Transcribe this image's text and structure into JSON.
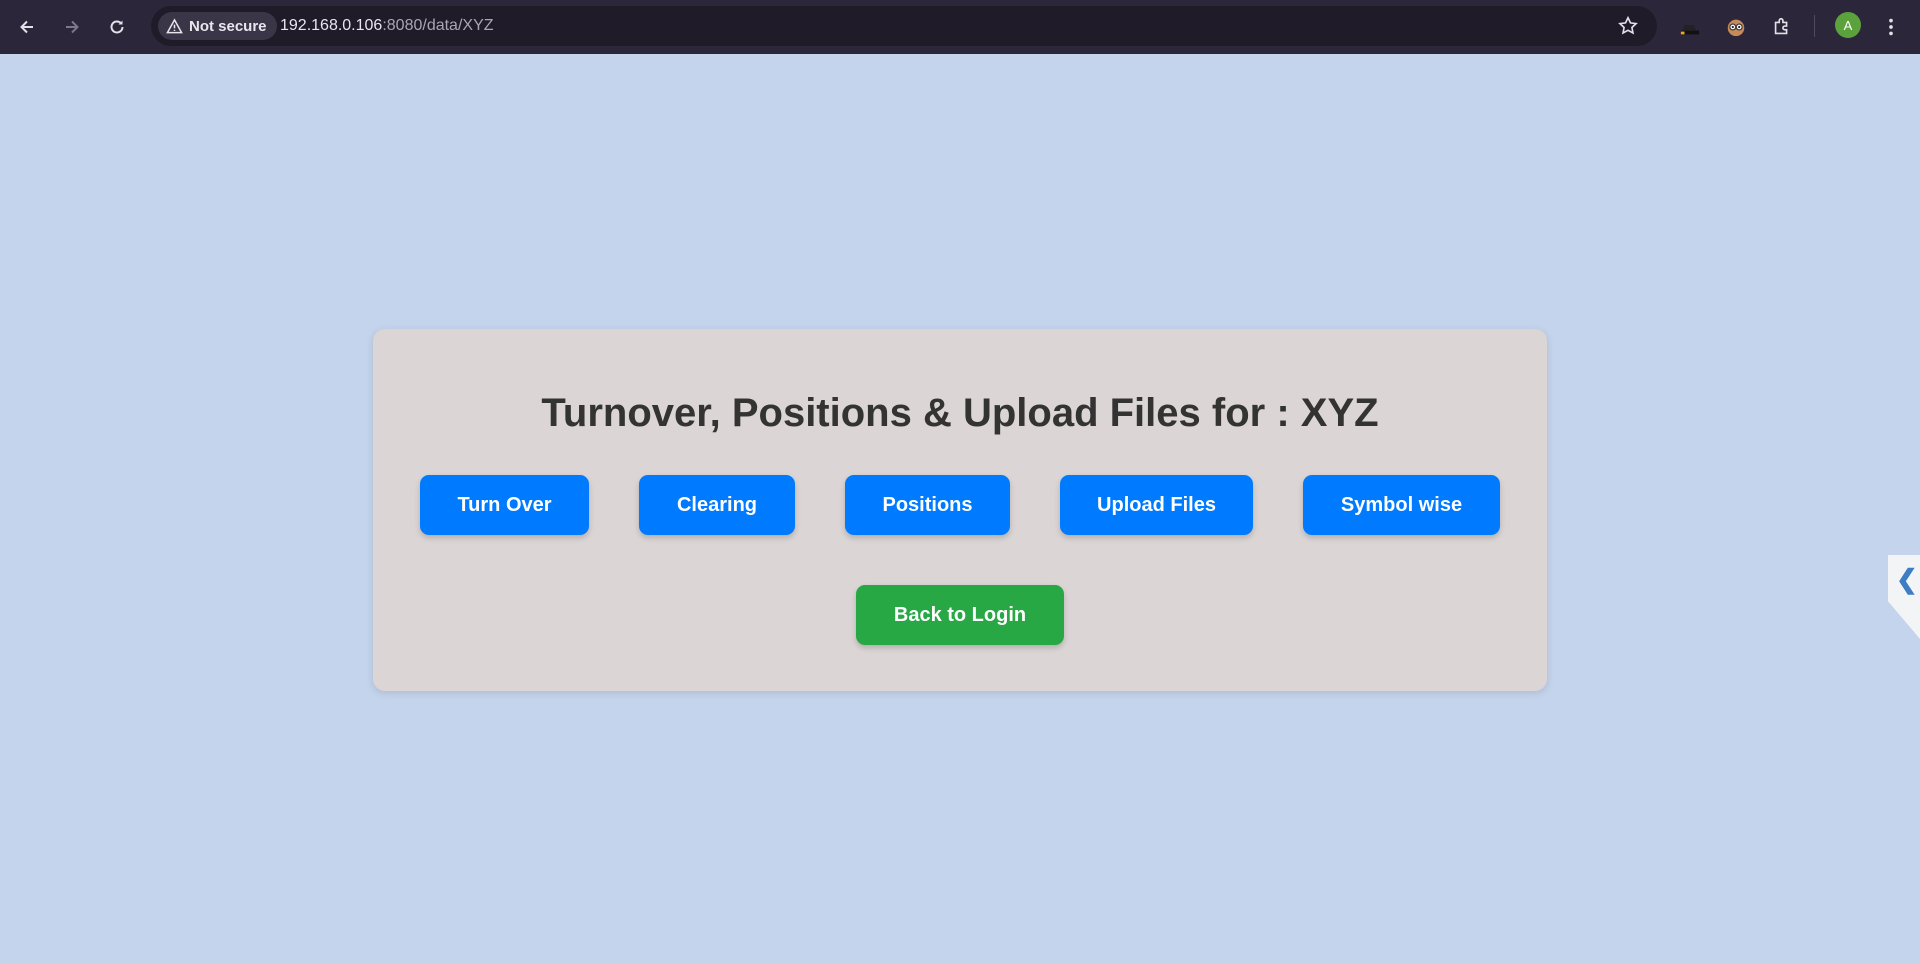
{
  "browser": {
    "security_label": "Not secure",
    "url_host": "192.168.0.106",
    "url_rest": ":8080/data/XYZ",
    "profile_initial": "A"
  },
  "page": {
    "title": "Turnover, Positions & Upload Files for : XYZ",
    "buttons": [
      {
        "label": "Turn Over"
      },
      {
        "label": "Clearing"
      },
      {
        "label": "Positions"
      },
      {
        "label": "Upload Files"
      },
      {
        "label": "Symbol wise"
      }
    ],
    "back_label": "Back to Login",
    "side_tab_glyph": "❮"
  },
  "colors": {
    "page_bg": "#c4d4ec",
    "card_bg": "#dbd5d5",
    "primary": "#007bff",
    "success": "#28a745"
  }
}
